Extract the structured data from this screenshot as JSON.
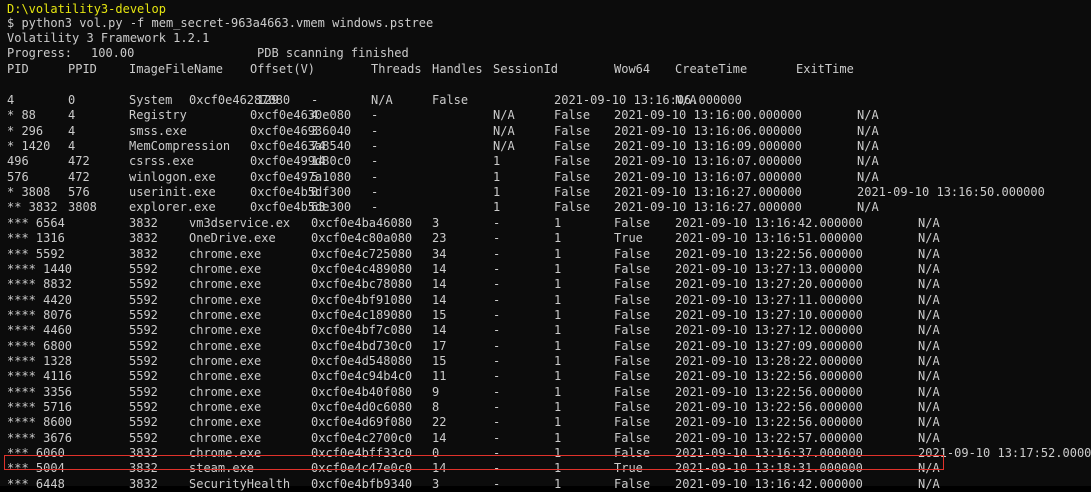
{
  "cwd": "D:\\volatility3-develop",
  "command": "$ python3 vol.py -f mem_secret-963a4663.vmem windows.pstree",
  "framework": "Volatility 3 Framework 1.2.1",
  "progress_label": "Progress:",
  "progress_value": "100.00",
  "progress_status": "PDB scanning finished",
  "headers": [
    "PID",
    "PPID",
    "ImageFileName",
    "Offset(V)",
    "Threads",
    "Handles",
    "SessionId",
    "Wow64",
    "CreateTime",
    "ExitTime"
  ],
  "rows": [
    [
      "4",
      "0",
      "System",
      "0xcf0e46287080",
      "129",
      "-",
      "N/A",
      "False",
      "2021-09-10 13:16:06.000000",
      "N/A"
    ],
    [
      "* 88",
      "4",
      "Registry",
      "0xcf0e4630e080",
      "4",
      "-",
      "N/A",
      "False",
      "2021-09-10 13:16:00.000000",
      "N/A"
    ],
    [
      "* 296",
      "4",
      "smss.exe",
      "0xcf0e46936040",
      "3",
      "-",
      "N/A",
      "False",
      "2021-09-10 13:16:06.000000",
      "N/A"
    ],
    [
      "* 1420",
      "4",
      "MemCompression",
      "0xcf0e463a8540",
      "74",
      "-",
      "N/A",
      "False",
      "2021-09-10 13:16:09.000000",
      "N/A"
    ],
    [
      "496",
      "472",
      "csrss.exe",
      "0xcf0e499d80c0",
      "14",
      "-",
      "1",
      "False",
      "2021-09-10 13:16:07.000000",
      "N/A"
    ],
    [
      "576",
      "472",
      "winlogon.exe",
      "0xcf0e497a1080",
      "5",
      "-",
      "1",
      "False",
      "2021-09-10 13:16:07.000000",
      "N/A"
    ],
    [
      "* 3808",
      "576",
      "userinit.exe",
      "0xcf0e4b5df300",
      "0",
      "-",
      "1",
      "False",
      "2021-09-10 13:16:27.000000",
      "2021-09-10 13:16:50.000000"
    ],
    [
      "** 3832",
      "3808",
      "explorer.exe",
      "0xcf0e4b5de300",
      "63",
      "-",
      "1",
      "False",
      "2021-09-10 13:16:27.000000",
      "N/A"
    ],
    [
      "*** 6564",
      "3832",
      "vm3dservice.ex",
      "0xcf0e4ba46080",
      "3",
      "-",
      "1",
      "False",
      "2021-09-10 13:16:42.000000",
      "N/A"
    ],
    [
      "*** 1316",
      "3832",
      "OneDrive.exe",
      "0xcf0e4c80a080",
      "23",
      "-",
      "1",
      "True",
      "2021-09-10 13:16:51.000000",
      "N/A"
    ],
    [
      "*** 5592",
      "3832",
      "chrome.exe",
      "0xcf0e4c725080",
      "34",
      "-",
      "1",
      "False",
      "2021-09-10 13:22:56.000000",
      "N/A"
    ],
    [
      "**** 1440",
      "5592",
      "chrome.exe",
      "0xcf0e4c489080",
      "14",
      "-",
      "1",
      "False",
      "2021-09-10 13:27:13.000000",
      "N/A"
    ],
    [
      "**** 8832",
      "5592",
      "chrome.exe",
      "0xcf0e4bc78080",
      "14",
      "-",
      "1",
      "False",
      "2021-09-10 13:27:20.000000",
      "N/A"
    ],
    [
      "**** 4420",
      "5592",
      "chrome.exe",
      "0xcf0e4bf91080",
      "14",
      "-",
      "1",
      "False",
      "2021-09-10 13:27:11.000000",
      "N/A"
    ],
    [
      "**** 8076",
      "5592",
      "chrome.exe",
      "0xcf0e4c189080",
      "15",
      "-",
      "1",
      "False",
      "2021-09-10 13:27:10.000000",
      "N/A"
    ],
    [
      "**** 4460",
      "5592",
      "chrome.exe",
      "0xcf0e4bf7c080",
      "14",
      "-",
      "1",
      "False",
      "2021-09-10 13:27:12.000000",
      "N/A"
    ],
    [
      "**** 6800",
      "5592",
      "chrome.exe",
      "0xcf0e4bd730c0",
      "17",
      "-",
      "1",
      "False",
      "2021-09-10 13:27:09.000000",
      "N/A"
    ],
    [
      "**** 1328",
      "5592",
      "chrome.exe",
      "0xcf0e4d548080",
      "15",
      "-",
      "1",
      "False",
      "2021-09-10 13:28:22.000000",
      "N/A"
    ],
    [
      "**** 4116",
      "5592",
      "chrome.exe",
      "0xcf0e4c94b4c0",
      "11",
      "-",
      "1",
      "False",
      "2021-09-10 13:22:56.000000",
      "N/A"
    ],
    [
      "**** 3356",
      "5592",
      "chrome.exe",
      "0xcf0e4b40f080",
      "9",
      "-",
      "1",
      "False",
      "2021-09-10 13:22:56.000000",
      "N/A"
    ],
    [
      "**** 5716",
      "5592",
      "chrome.exe",
      "0xcf0e4d0c6080",
      "8",
      "-",
      "1",
      "False",
      "2021-09-10 13:22:56.000000",
      "N/A"
    ],
    [
      "**** 8600",
      "5592",
      "chrome.exe",
      "0xcf0e4d69f080",
      "22",
      "-",
      "1",
      "False",
      "2021-09-10 13:22:56.000000",
      "N/A"
    ],
    [
      "**** 3676",
      "5592",
      "chrome.exe",
      "0xcf0e4c2700c0",
      "14",
      "-",
      "1",
      "False",
      "2021-09-10 13:22:57.000000",
      "N/A"
    ],
    [
      "*** 6060",
      "3832",
      "chrome.exe",
      "0xcf0e4bff33c0",
      "0",
      "-",
      "1",
      "False",
      "2021-09-10 13:16:37.000000",
      "2021-09-10 13:17:52.000000"
    ],
    [
      "*** 5004",
      "3832",
      "steam.exe",
      "0xcf0e4c47e0c0",
      "14",
      "-",
      "1",
      "True",
      "2021-09-10 13:18:31.000000",
      "N/A"
    ],
    [
      "*** 6448",
      "3832",
      "SecurityHealth",
      "0xcf0e4bfb9340",
      "3",
      "-",
      "1",
      "False",
      "2021-09-10 13:16:42.000000",
      "N/A"
    ]
  ],
  "highlighted_row_index": 24,
  "colors": {
    "background": "#0c0c0c",
    "text": "#cccccc",
    "cwd": "#e5e510",
    "highlight_border": "#e0322b"
  }
}
